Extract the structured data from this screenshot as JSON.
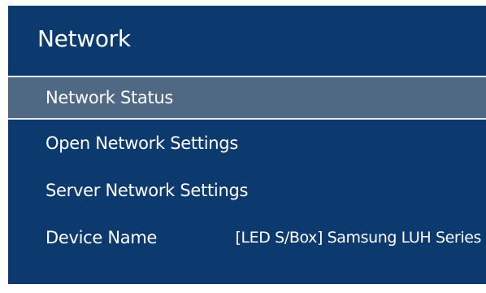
{
  "menu": {
    "title": "Network",
    "items": [
      {
        "label": "Network Status",
        "selected": true
      },
      {
        "label": "Open Network Settings",
        "selected": false
      },
      {
        "label": "Server Network Settings",
        "selected": false
      },
      {
        "label": "Device Name",
        "value": "[LED S/Box] Samsung LUH Series",
        "selected": false
      }
    ]
  },
  "colors": {
    "panel_background": "#0c3a6f",
    "selected_background": "#4f6985",
    "selected_border": "#e4e9ef",
    "text": "#ffffff"
  }
}
